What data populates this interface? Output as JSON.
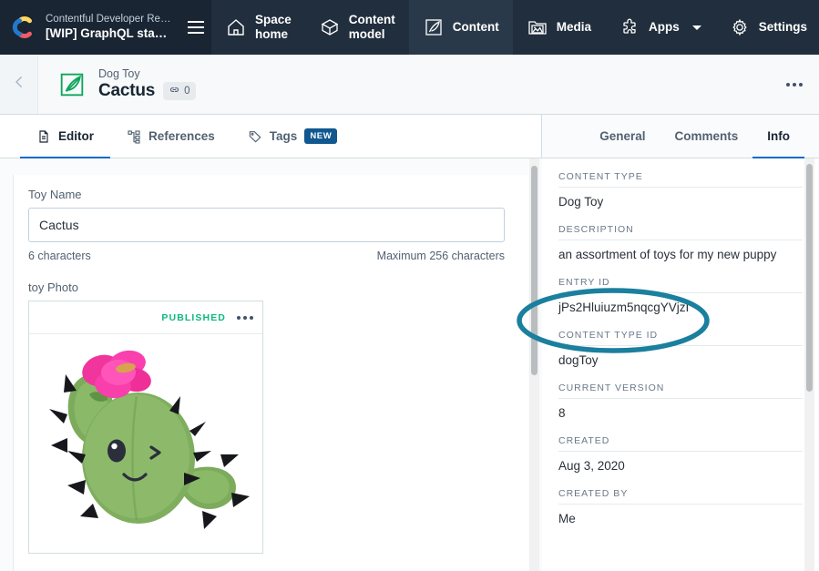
{
  "topnav": {
    "org_name": "Contentful Developer Rel...",
    "space_name": "[WIP] GraphQL starter",
    "logo_name": "contentful-logo",
    "menu_icon": "hamburger-icon",
    "items": [
      {
        "label": "Space home",
        "icon": "home-icon",
        "active": false,
        "caret": false
      },
      {
        "label": "Content model",
        "icon": "cube-icon",
        "active": false,
        "caret": false
      },
      {
        "label": "Content",
        "icon": "entry-quill-icon",
        "active": true,
        "caret": false
      },
      {
        "label": "Media",
        "icon": "media-image-icon",
        "active": false,
        "caret": false
      },
      {
        "label": "Apps",
        "icon": "puzzle-icon",
        "active": false,
        "caret": true
      },
      {
        "label": "Settings",
        "icon": "gear-icon",
        "active": false,
        "caret": true
      }
    ]
  },
  "entry_header": {
    "back_icon": "chevron-left-icon",
    "entry_icon": "entry-quill-icon",
    "content_type": "Dog Toy",
    "title": "Cactus",
    "link_count": "0",
    "link_icon": "link-icon",
    "actions_icon": "more-options-icon"
  },
  "editor_tabs": [
    {
      "label": "Editor",
      "icon": "document-icon",
      "active": true,
      "badge": ""
    },
    {
      "label": "References",
      "icon": "references-icon",
      "active": false,
      "badge": ""
    },
    {
      "label": "Tags",
      "icon": "tag-icon",
      "active": false,
      "badge": "NEW"
    }
  ],
  "editor": {
    "toy_name": {
      "label": "Toy Name",
      "value": "Cactus",
      "placeholder": "",
      "char_count": "6 characters",
      "max_chars": "Maximum 256 characters"
    },
    "toy_photo": {
      "label": "toy Photo",
      "status": "PUBLISHED",
      "options_icon": "more-options-icon",
      "image_alt": "green cactus plush toy with pink flower"
    }
  },
  "sidebar_tabs": [
    {
      "label": "General",
      "active": false
    },
    {
      "label": "Comments",
      "active": false
    },
    {
      "label": "Info",
      "active": true
    }
  ],
  "info": {
    "items": [
      {
        "label": "CONTENT TYPE",
        "value": "Dog Toy"
      },
      {
        "label": "DESCRIPTION",
        "value": "an assortment of toys for my new puppy"
      },
      {
        "label": "ENTRY ID",
        "value": "jPs2Hluiuzm5nqcgYVjzI"
      },
      {
        "label": "CONTENT TYPE ID",
        "value": "dogToy"
      },
      {
        "label": "CURRENT VERSION",
        "value": "8"
      },
      {
        "label": "CREATED",
        "value": "Aug 3, 2020"
      },
      {
        "label": "CREATED BY",
        "value": "Me"
      }
    ]
  },
  "annotation": {
    "name": "entry-id-highlight-ellipse",
    "color": "#1b7f9e",
    "target": "ENTRY ID"
  },
  "colors": {
    "nav_bg": "#192532",
    "nav_items_bg": "#202e3d",
    "nav_active_bg": "#2a3949",
    "accent_blue": "#0b6ac8",
    "published_green": "#0eb87f",
    "badge_blue": "#10588f",
    "teal_annotation": "#1b7f9e"
  }
}
